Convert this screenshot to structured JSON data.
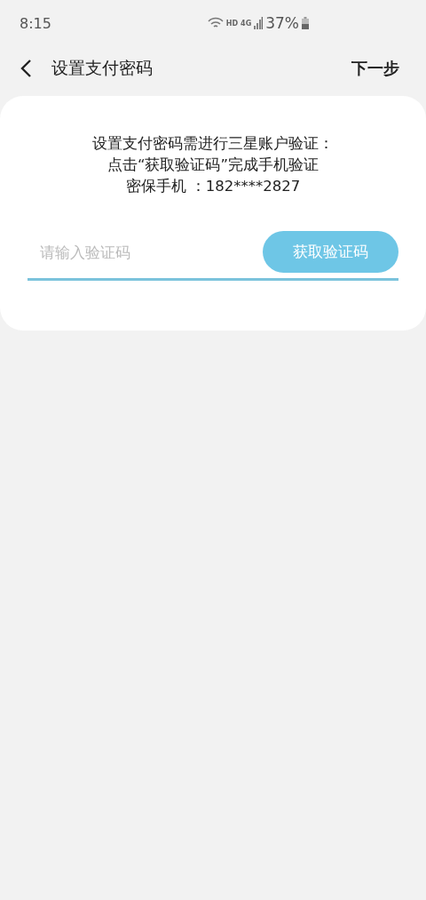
{
  "status_bar": {
    "time": "8:15",
    "hd": "HD",
    "network": "4G",
    "battery": "37%"
  },
  "header": {
    "title": "设置支付密码",
    "next": "下一步"
  },
  "card": {
    "lines": [
      "设置支付密码需进行三星账户验证：",
      "点击“获取验证码”完成手机验证",
      "密保手机 ：182****2827"
    ],
    "code_field": {
      "placeholder": "请输入验证码"
    },
    "get_code_button": "获取验证码"
  }
}
